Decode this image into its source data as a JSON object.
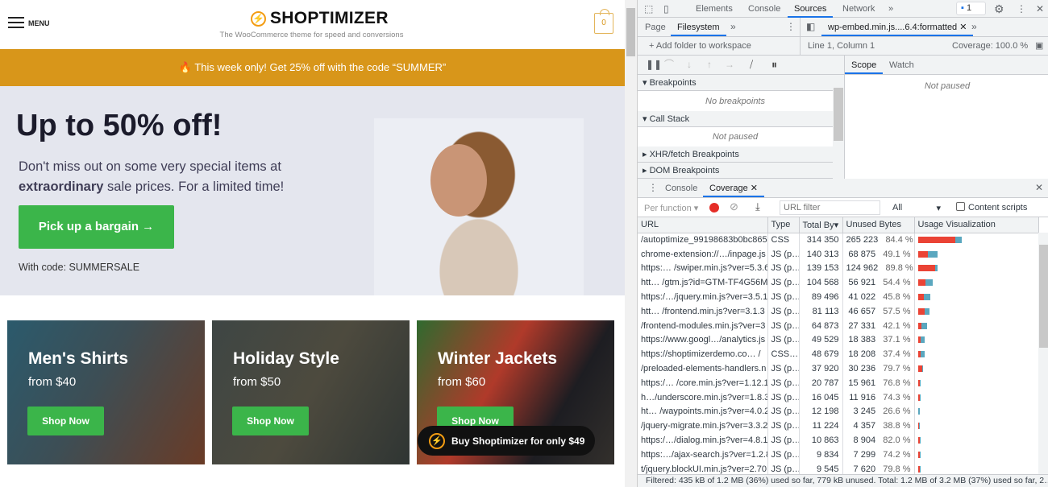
{
  "site": {
    "menu_label": "MENU",
    "logo_text": "SHOPTIMIZER",
    "tagline": "The WooCommerce theme for speed and conversions",
    "cart_count": "0",
    "banner": "🔥 This week only! Get 25% off with the code “SUMMER”",
    "hero": {
      "title": "Up to 50% off!",
      "sub_pre": "Don't miss out on some very special items at ",
      "sub_bold": "extraordinary",
      "sub_post": " sale prices. For a limited time!",
      "cta": "Pick up a bargain →",
      "code": "With code: SUMMERSALE"
    },
    "cards": [
      {
        "title": "Men's Shirts",
        "price": "from $40",
        "button": "Shop Now"
      },
      {
        "title": "Holiday Style",
        "price": "from $50",
        "button": "Shop Now"
      },
      {
        "title": "Winter Jackets",
        "price": "from $60",
        "button": "Shop Now"
      }
    ],
    "buy_pill": "Buy Shoptimizer for only $49",
    "colors": {
      "accent": "#d8961a",
      "green": "#3bb54a",
      "logo": "#f39c12"
    }
  },
  "devtools": {
    "tabs": [
      "Elements",
      "Console",
      "Sources",
      "Network"
    ],
    "active_tab": "Sources",
    "more": "»",
    "issues_badge": "1",
    "nav_tabs": [
      "Page",
      "Filesystem"
    ],
    "active_nav": "Filesystem",
    "file_tab": "wp-embed.min.js....6.4:formatted",
    "add_folder": "Add folder to workspace",
    "position": "Line 1, Column 1",
    "coverage": "Coverage: 100.0 %",
    "scope_tabs": [
      "Scope",
      "Watch"
    ],
    "scope_empty": "Not paused",
    "sections": {
      "breakpoints": "Breakpoints",
      "no_breakpoints": "No breakpoints",
      "call_stack": "Call Stack",
      "not_paused": "Not paused",
      "xhr": "XHR/fetch Breakpoints",
      "dom": "DOM Breakpoints"
    },
    "drawer_tabs": [
      "Console",
      "Coverage"
    ],
    "active_drawer": "Coverage",
    "cov_toolbar": {
      "mode": "Per function",
      "url_filter_placeholder": "URL filter",
      "type_select": "All",
      "content_scripts": "Content scripts"
    },
    "columns": [
      "URL",
      "Type",
      "Total By▾",
      "Unused Bytes",
      "Usage Visualization"
    ],
    "rows": [
      {
        "url": "/autoptimize_99198683b0bc865",
        "type": "CSS",
        "total": "314 350",
        "unused": "265 223",
        "pct": "84.4 %",
        "t": 314350,
        "u": 265223
      },
      {
        "url": "chrome-extension://…/inpage.js",
        "type": "JS (p…",
        "total": "140 313",
        "unused": "68 875",
        "pct": "49.1 %",
        "t": 140313,
        "u": 68875
      },
      {
        "url": "https:… /swiper.min.js?ver=5.3.6",
        "type": "JS (p…",
        "total": "139 153",
        "unused": "124 962",
        "pct": "89.8 %",
        "t": 139153,
        "u": 124962
      },
      {
        "url": "htt… /gtm.js?id=GTM-TF4G56M",
        "type": "JS (p…",
        "total": "104 568",
        "unused": "56 921",
        "pct": "54.4 %",
        "t": 104568,
        "u": 56921
      },
      {
        "url": "https:/…/jquery.min.js?ver=3.5.1",
        "type": "JS (p…",
        "total": "89 496",
        "unused": "41 022",
        "pct": "45.8 %",
        "t": 89496,
        "u": 41022
      },
      {
        "url": "htt…  /frontend.min.js?ver=3.1.3",
        "type": "JS (p…",
        "total": "81 113",
        "unused": "46 657",
        "pct": "57.5 %",
        "t": 81113,
        "u": 46657
      },
      {
        "url": "/frontend-modules.min.js?ver=3",
        "type": "JS (p…",
        "total": "64 873",
        "unused": "27 331",
        "pct": "42.1 %",
        "t": 64873,
        "u": 27331
      },
      {
        "url": "https://www.googl…/analytics.js",
        "type": "JS (p…",
        "total": "49 529",
        "unused": "18 383",
        "pct": "37.1 %",
        "t": 49529,
        "u": 18383
      },
      {
        "url": "https://shoptimizerdemo.co…  /",
        "type": "CSS…",
        "total": "48 679",
        "unused": "18 208",
        "pct": "37.4 %",
        "t": 48679,
        "u": 18208
      },
      {
        "url": "/preloaded-elements-handlers.n",
        "type": "JS (p…",
        "total": "37 920",
        "unused": "30 236",
        "pct": "79.7 %",
        "t": 37920,
        "u": 30236
      },
      {
        "url": "https:/… /core.min.js?ver=1.12.1",
        "type": "JS (p…",
        "total": "20 787",
        "unused": "15 961",
        "pct": "76.8 %",
        "t": 20787,
        "u": 15961
      },
      {
        "url": "h…/underscore.min.js?ver=1.8.3",
        "type": "JS (p…",
        "total": "16 045",
        "unused": "11 916",
        "pct": "74.3 %",
        "t": 16045,
        "u": 11916
      },
      {
        "url": "ht… /waypoints.min.js?ver=4.0.2",
        "type": "JS (p…",
        "total": "12 198",
        "unused": "3 245",
        "pct": "26.6 %",
        "t": 12198,
        "u": 3245
      },
      {
        "url": "/jquery-migrate.min.js?ver=3.3.2",
        "type": "JS (p…",
        "total": "11 224",
        "unused": "4 357",
        "pct": "38.8 %",
        "t": 11224,
        "u": 4357
      },
      {
        "url": "https:/…/dialog.min.js?ver=4.8.1",
        "type": "JS (p…",
        "total": "10 863",
        "unused": "8 904",
        "pct": "82.0 %",
        "t": 10863,
        "u": 8904
      },
      {
        "url": "https:…/ajax-search.js?ver=1.2.8",
        "type": "JS (p…",
        "total": "9 834",
        "unused": "7 299",
        "pct": "74.2 %",
        "t": 9834,
        "u": 7299
      },
      {
        "url": "t/jquery.blockUI.min.js?ver=2.70",
        "type": "JS (p…",
        "total": "9 545",
        "unused": "7 620",
        "pct": "79.8 %",
        "t": 9545,
        "u": 7620
      }
    ],
    "status": "Filtered: 435 kB of 1.2 MB (36%) used so far, 779 kB unused. Total: 1.2 MB of 3.2 MB (37%) used so far, 2…",
    "colors": {
      "unused": "#ea4335",
      "used": "#5aa7bf",
      "active": "#1a73e8"
    }
  }
}
